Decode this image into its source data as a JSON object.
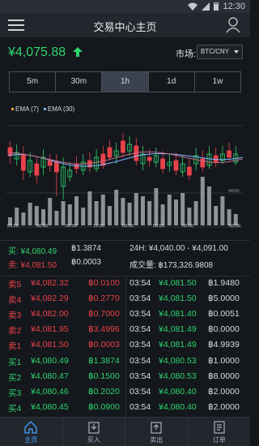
{
  "status": {
    "time": "12:30"
  },
  "header": {
    "title": "交易中心主页"
  },
  "price": {
    "value": "¥4,075.88"
  },
  "market": {
    "label": "市场:",
    "selected": "BTC/CNY"
  },
  "tabs": [
    {
      "label": "5m",
      "active": false
    },
    {
      "label": "30m",
      "active": false
    },
    {
      "label": "1h",
      "active": true
    },
    {
      "label": "1d",
      "active": false
    },
    {
      "label": "1w",
      "active": false
    }
  ],
  "chart_data": {
    "type": "candlestick",
    "legend": [
      {
        "label": "EMA (7)",
        "color": "#f0a53a"
      },
      {
        "label": "EMA (30)",
        "color": "#7fb7ff"
      }
    ],
    "x_ticks": [
      "03:00",
      "06:00",
      "09:00",
      "12:00",
      "03:00",
      "06:00",
      "09:00",
      "03:00"
    ],
    "y_axis_label": "¥4080"
  },
  "summary": {
    "buy_label": "买: ¥4,080.49",
    "buy_amount": "฿1.3874",
    "sell_label": "卖: ¥4,081.50",
    "sell_amount": "฿0.0003",
    "range_label": "24H: ¥4,040.00 - ¥4,091.00",
    "volume_label": "成交量: ฿173,326.9808"
  },
  "orderbook": {
    "asks": [
      {
        "label": "卖5",
        "price": "¥4,082.32",
        "amount": "฿0.0100"
      },
      {
        "label": "卖4",
        "price": "¥4,082.29",
        "amount": "฿0.2770"
      },
      {
        "label": "卖3",
        "price": "¥4,082.00",
        "amount": "฿0.7000"
      },
      {
        "label": "卖2",
        "price": "¥4,081.95",
        "amount": "฿3.4996"
      },
      {
        "label": "卖1",
        "price": "¥4,081.50",
        "amount": "฿0.0003"
      }
    ],
    "bids": [
      {
        "label": "买1",
        "price": "¥4,080.49",
        "amount": "฿1.3874"
      },
      {
        "label": "买2",
        "price": "¥4,080.47",
        "amount": "฿0.1500"
      },
      {
        "label": "买3",
        "price": "¥4,080.46",
        "amount": "฿0.2020"
      },
      {
        "label": "买4",
        "price": "¥4,080.45",
        "amount": "฿0.0900"
      }
    ],
    "trades": [
      {
        "time": "03:54",
        "price": "¥4,081.50",
        "amount": "฿1.9480",
        "side": "buy"
      },
      {
        "time": "03:54",
        "price": "¥4,081.50",
        "amount": "฿5.0000",
        "side": "buy"
      },
      {
        "time": "03:54",
        "price": "¥4,081.40",
        "amount": "฿0.0051",
        "side": "buy"
      },
      {
        "time": "03:54",
        "price": "¥4,081.49",
        "amount": "฿0.0000",
        "side": "buy"
      },
      {
        "time": "03:54",
        "price": "¥4,081.49",
        "amount": "฿4.9939",
        "side": "buy"
      },
      {
        "time": "03:54",
        "price": "¥4,080.53",
        "amount": "฿1.0000",
        "side": "buy"
      },
      {
        "time": "03:54",
        "price": "¥4,080.53",
        "amount": "฿8.0000",
        "side": "buy"
      },
      {
        "time": "03:54",
        "price": "¥4,080.40",
        "amount": "฿2.0000",
        "side": "buy"
      },
      {
        "time": "03:54",
        "price": "¥4,080.40",
        "amount": "฿2.0000",
        "side": "buy"
      }
    ]
  },
  "nav": [
    {
      "label": "主页",
      "icon": "home-icon",
      "active": true
    },
    {
      "label": "买入",
      "icon": "buy-icon",
      "active": false
    },
    {
      "label": "卖出",
      "icon": "sell-icon",
      "active": false
    },
    {
      "label": "订单",
      "icon": "orders-icon",
      "active": false
    }
  ]
}
